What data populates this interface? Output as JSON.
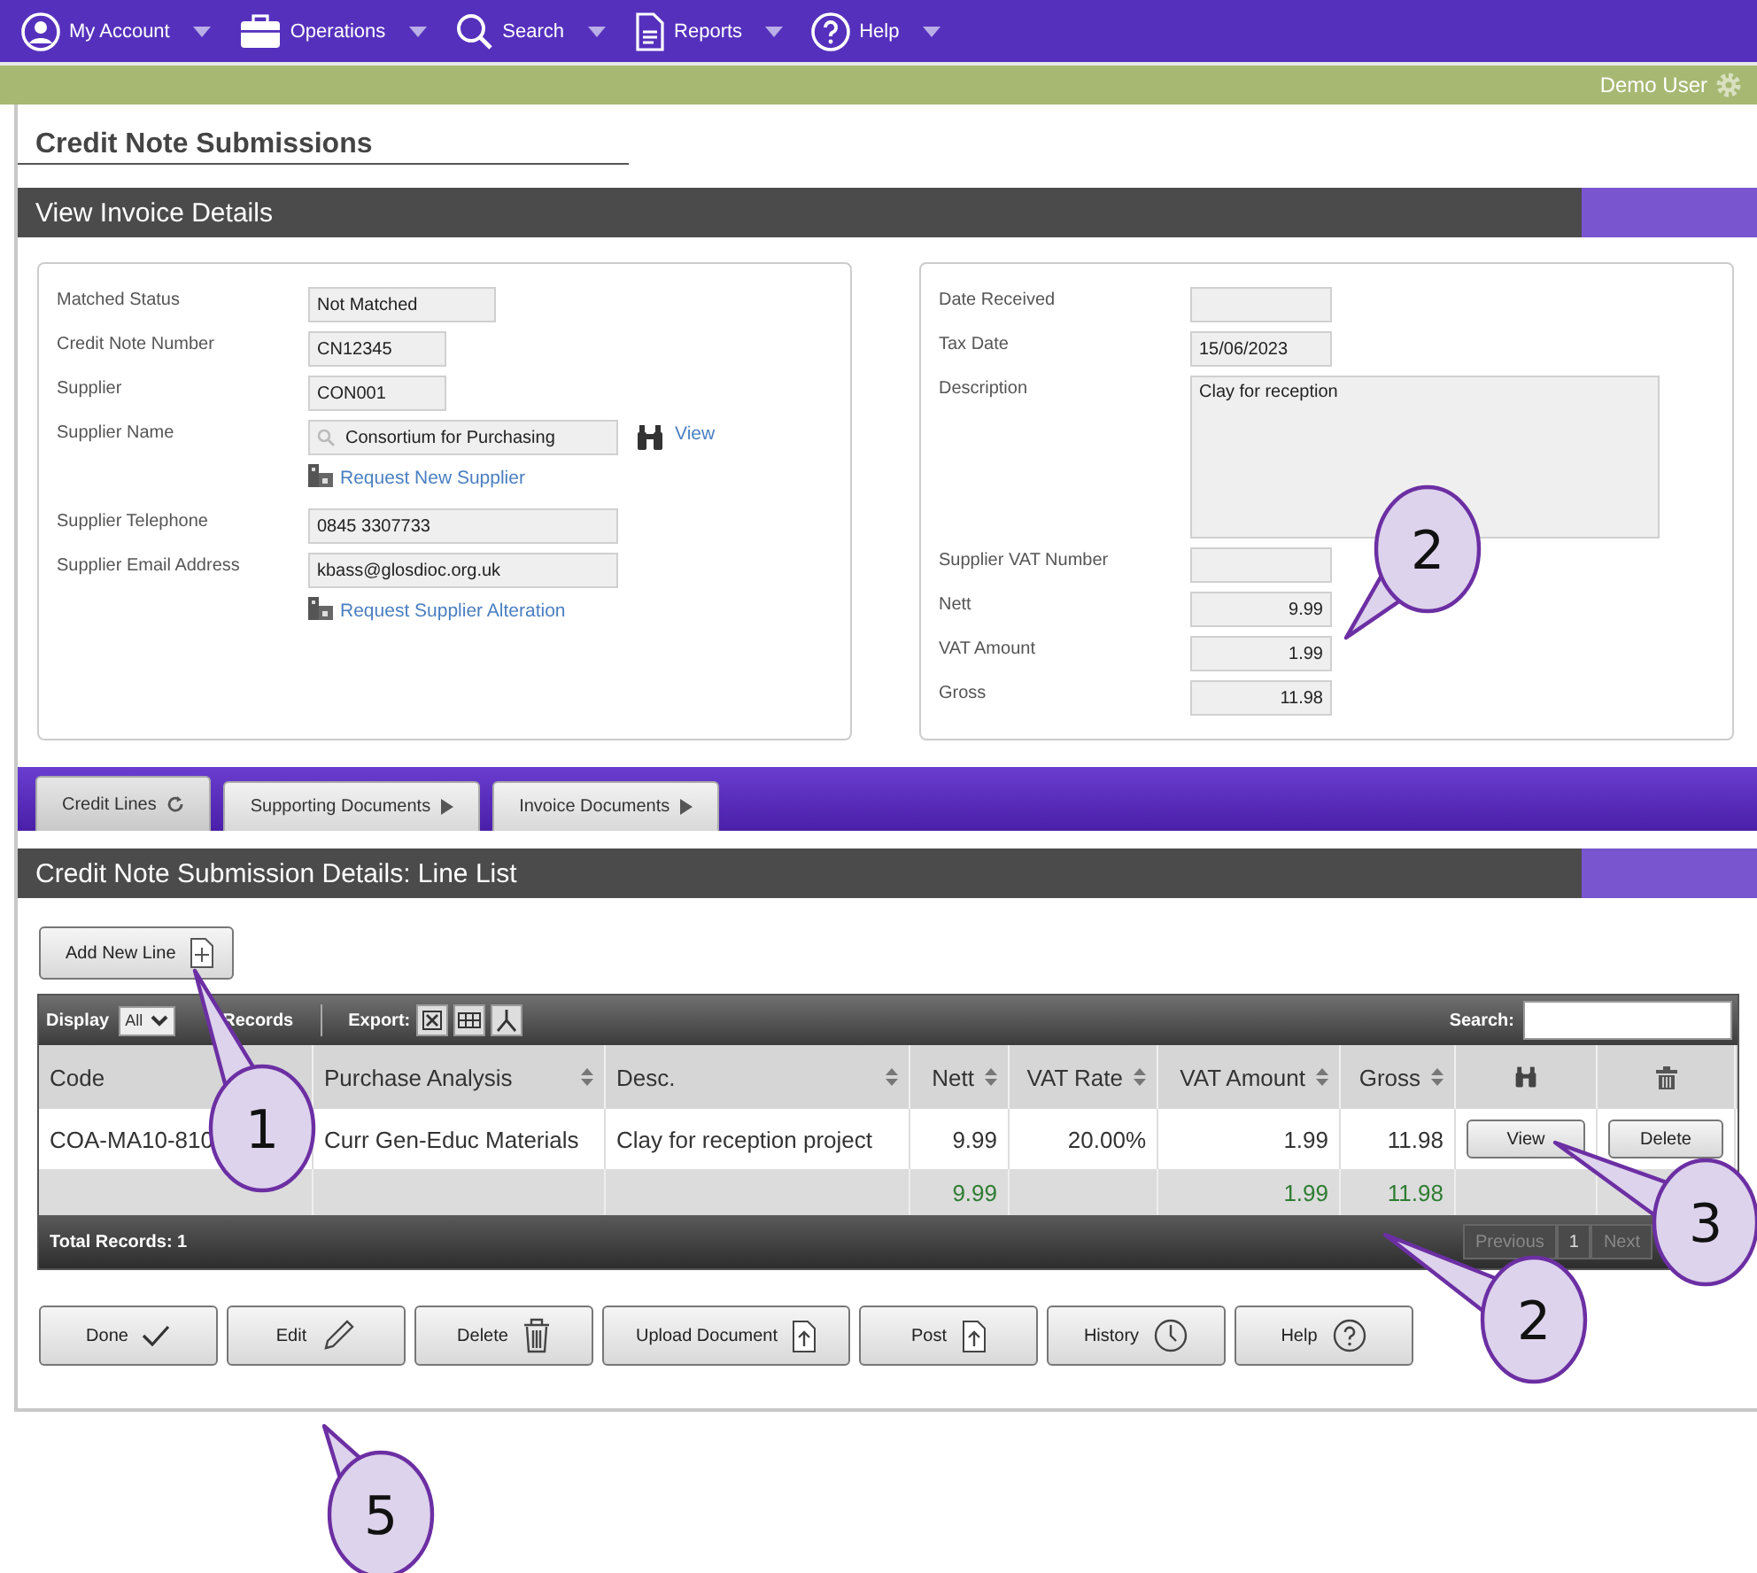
{
  "nav": [
    {
      "label": "My Account"
    },
    {
      "label": "Operations"
    },
    {
      "label": "Search"
    },
    {
      "label": "Reports"
    },
    {
      "label": "Help"
    }
  ],
  "user_bar": {
    "user": "Demo User"
  },
  "page_title": "Credit Note Submissions",
  "invoice": {
    "title": "View Invoice Details",
    "left": [
      {
        "kind": "field",
        "label": "Matched Status",
        "value": "Not Matched"
      },
      {
        "kind": "field",
        "label": "Credit Note Number",
        "value": "CN12345"
      },
      {
        "kind": "field",
        "label": "Supplier",
        "value": "CON001"
      },
      {
        "kind": "lookup",
        "label": "Supplier Name",
        "value": "Consortium for Purchasing",
        "link": "View"
      },
      {
        "kind": "link",
        "link": "Request New Supplier"
      },
      {
        "kind": "field",
        "label": "Supplier Telephone",
        "value": "0845 3307733"
      },
      {
        "kind": "field",
        "label": "Supplier Email Address",
        "value": "kbass@glosdioc.org.uk"
      },
      {
        "kind": "link",
        "link": "Request Supplier Alteration"
      }
    ],
    "right": [
      {
        "kind": "field",
        "label": "Date Received"
      },
      {
        "kind": "field",
        "label": "Tax Date",
        "value": "15/06/2023"
      },
      {
        "kind": "textarea",
        "label": "Description",
        "value": "Clay for reception"
      },
      {
        "kind": "field",
        "label": "Supplier VAT Number"
      },
      {
        "kind": "amount",
        "label": "Nett",
        "value": "9.99"
      },
      {
        "kind": "amount",
        "label": "VAT Amount",
        "value": "1.99"
      },
      {
        "kind": "amount",
        "label": "Gross",
        "value": "11.98"
      }
    ]
  },
  "tabs": [
    {
      "label": "Credit Lines",
      "selected": true
    },
    {
      "label": "Supporting Documents",
      "selected": false
    },
    {
      "label": "Invoice Documents",
      "selected": false
    }
  ],
  "line_list": {
    "title": "Credit Note Submission Details: Line List",
    "add_button": "Add New Line",
    "toolbar": {
      "display_label": "Display",
      "page_size": "All",
      "records_label": "Records",
      "export_label": "Export:",
      "search_label": "Search:"
    },
    "columns": [
      "Code",
      "Purchase Analysis",
      "Desc.",
      "Nett",
      "VAT Rate",
      "VAT Amount",
      "Gross"
    ],
    "rows": [
      {
        "cells": [
          "COA-MA10-810",
          "Curr Gen-Educ Materials",
          "Clay for reception project",
          "9.99",
          "20.00%",
          "1.99",
          "11.98"
        ],
        "view": "View",
        "delete": "Delete"
      }
    ],
    "totals": {
      "nett": "9.99",
      "vat_amount": "1.99",
      "gross": "11.98"
    },
    "total_records": "Total Records: 1",
    "pager": [
      {
        "label": "Previous",
        "disabled": true
      },
      {
        "label": "1",
        "disabled": false
      },
      {
        "label": "Next",
        "disabled": true
      }
    ]
  },
  "actions": [
    "Done",
    "Edit",
    "Delete",
    "Upload Document",
    "Post",
    "History",
    "Help"
  ],
  "callouts": [
    "2",
    "1",
    "3",
    "2",
    "5"
  ]
}
